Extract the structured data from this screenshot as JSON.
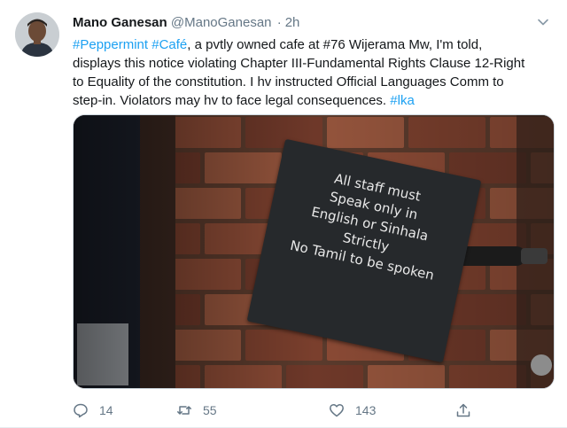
{
  "tweet": {
    "author_name": "Mano Ganesan",
    "author_handle": "@ManoGanesan",
    "separator": "·",
    "time": "2h",
    "text_lines": [
      [
        {
          "text": "#Peppermint",
          "link": true
        },
        {
          "text": " ",
          "link": false
        },
        {
          "text": "#Café",
          "link": true
        },
        {
          "text": ", a pvtly owned cafe at #76 Wijerama Mw, I'm told,",
          "link": false
        }
      ],
      [
        {
          "text": "displays this notice violating Chapter III-Fundamental Rights Clause 12-Right",
          "link": false
        }
      ],
      [
        {
          "text": "to Equality of the constitution. I hv instructed Official Languages Comm to",
          "link": false
        }
      ],
      [
        {
          "text": "step-in. Violators may hv to face legal consequences. ",
          "link": false
        },
        {
          "text": "#lka",
          "link": true
        }
      ]
    ]
  },
  "media": {
    "sign_lines": [
      "All staff must",
      "Speak only in",
      "English or Sinhala",
      "Strictly",
      "No Tamil to be spoken"
    ]
  },
  "actions": {
    "reply_count": "14",
    "retweet_count": "55",
    "like_count": "143"
  },
  "colors": {
    "link": "#1da1f2",
    "secondary_text": "#657786",
    "brick": "#8a4a35",
    "sign": "#26292c"
  },
  "icons": [
    "avatar-photo",
    "chevron-down-icon",
    "reply-icon",
    "retweet-icon",
    "like-icon",
    "share-icon"
  ]
}
